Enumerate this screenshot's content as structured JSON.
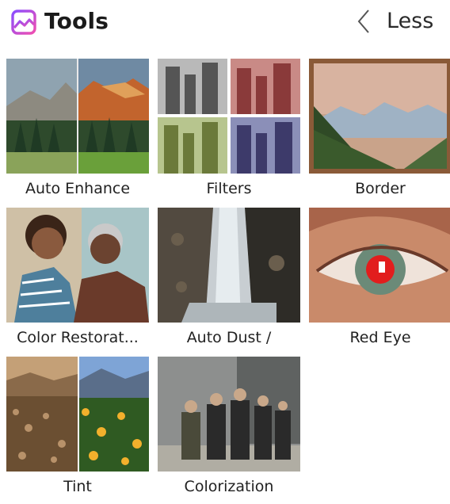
{
  "panel": {
    "title": "Tools",
    "title_icon": "image-icon",
    "collapse": {
      "label": "Less",
      "icon": "chevron-left-icon"
    }
  },
  "tools": [
    {
      "label": "Auto Enhance"
    },
    {
      "label": "Filters"
    },
    {
      "label": "Border"
    },
    {
      "label": "Color Restorat..."
    },
    {
      "label": "Auto Dust /"
    },
    {
      "label": "Red Eye"
    },
    {
      "label": "Tint"
    },
    {
      "label": "Colorization"
    }
  ],
  "colors": {
    "accent": "#cc3fd6",
    "text": "#1b1b1b"
  }
}
